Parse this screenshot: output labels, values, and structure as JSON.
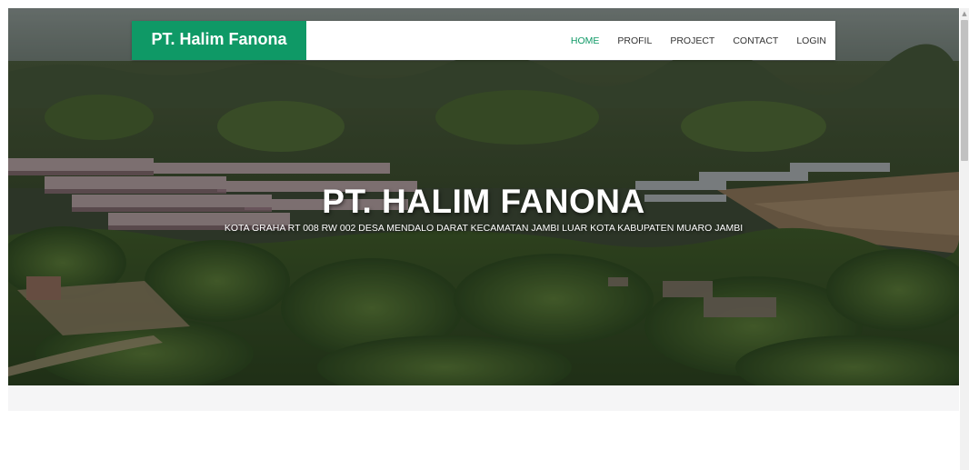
{
  "navbar": {
    "brand": "PT. Halim Fanona",
    "items": [
      {
        "label": "HOME",
        "active": true
      },
      {
        "label": "PROFIL",
        "active": false
      },
      {
        "label": "PROJECT",
        "active": false
      },
      {
        "label": "CONTACT",
        "active": false
      },
      {
        "label": "LOGIN",
        "active": false
      }
    ]
  },
  "hero": {
    "title": "PT. HALIM FANONA",
    "address": "KOTA GRAHA RT 008 RW 002 DESA MENDALO DARAT KECAMATAN JAMBI LUAR KOTA KABUPATEN MUARO JAMBI",
    "background_image": "aerial-housing-forest-photo"
  },
  "colors": {
    "brand": "#0f9966",
    "nav_text": "#333333",
    "band": "#f5f5f6"
  }
}
